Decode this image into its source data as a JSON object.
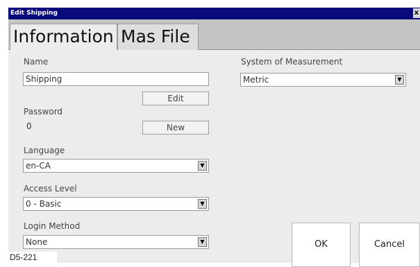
{
  "window": {
    "title": "Edit Shipping",
    "close_glyph": "x"
  },
  "tabs": [
    {
      "label": "Information",
      "active": true
    },
    {
      "label": "Mas File",
      "active": false
    }
  ],
  "form": {
    "name_label": "Name",
    "name_value": "Shipping",
    "edit_label": "Edit",
    "password_label": "Password",
    "password_value": "0",
    "new_label": "New",
    "language_label": "Language",
    "language_value": "en-CA",
    "access_level_label": "Access Level",
    "access_level_value": "0 - Basic",
    "login_method_label": "Login Method",
    "login_method_value": "None",
    "measurement_label": "System of Measurement",
    "measurement_value": "Metric"
  },
  "actions": {
    "ok_label": "OK",
    "cancel_label": "Cancel"
  },
  "figure_label": "D5-221",
  "icons": {
    "dropdown": "chevron-down-icon",
    "close": "close-icon"
  },
  "colors": {
    "titlebar": "#0a0a7a",
    "panel": "#ececec",
    "tabstrip": "#c4c4c4"
  }
}
